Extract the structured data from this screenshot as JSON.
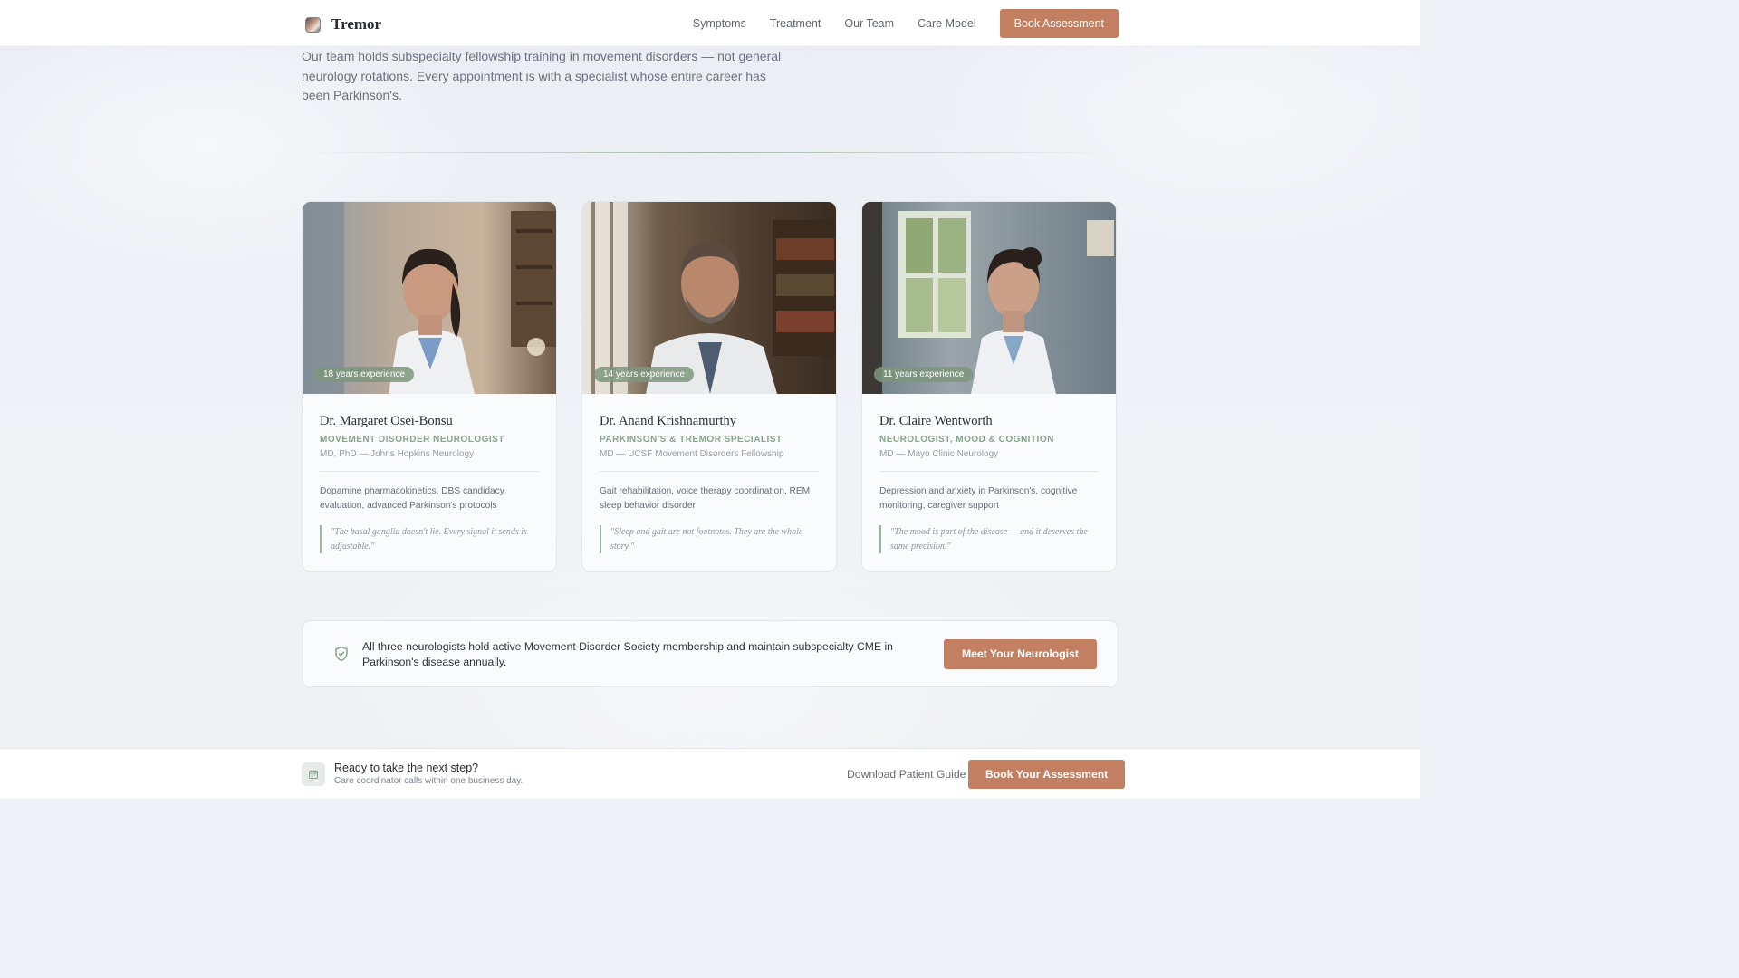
{
  "brand": {
    "name": "Tremor"
  },
  "nav": {
    "items": [
      "Symptoms",
      "Treatment",
      "Our Team",
      "Care Model"
    ],
    "cta_label": "Book Assessment"
  },
  "intro": {
    "text": "Our team holds subspecialty fellowship training in movement disorders — not general neurology rotations. Every appointment is with a specialist whose entire career has been Parkinson's."
  },
  "doctors": [
    {
      "experience": "18 years experience",
      "name": "Dr. Margaret Osei-Bonsu",
      "title": "MOVEMENT DISORDER NEUROLOGIST",
      "credentials": "MD, PhD — Johns Hopkins Neurology",
      "focus": "Dopamine pharmacokinetics, DBS candidacy evaluation, advanced Parkinson's protocols",
      "quote": "\"The basal ganglia doesn't lie. Every signal it sends is adjustable.\""
    },
    {
      "experience": "14 years experience",
      "name": "Dr. Anand Krishnamurthy",
      "title": "PARKINSON'S & TREMOR SPECIALIST",
      "credentials": "MD — UCSF Movement Disorders Fellowship",
      "focus": "Gait rehabilitation, voice therapy coordination, REM sleep behavior disorder",
      "quote": "\"Sleep and gait are not footnotes. They are the whole story.\""
    },
    {
      "experience": "11 years experience",
      "name": "Dr. Claire Wentworth",
      "title": "NEUROLOGIST, MOOD & COGNITION",
      "credentials": "MD — Mayo Clinic Neurology",
      "focus": "Depression and anxiety in Parkinson's, cognitive monitoring, caregiver support",
      "quote": "\"The mood is part of the disease — and it deserves the same precision.\""
    }
  ],
  "banner": {
    "icon": "shield-check-icon",
    "text": "All three neurologists hold active Movement Disorder Society membership and maintain subspecialty CME in Parkinson's disease annually.",
    "cta_label": "Meet Your Neurologist"
  },
  "sticky_bar": {
    "icon": "calendar-icon",
    "title": "Ready to take the next step?",
    "subtitle": "Care coordinator calls within one business day.",
    "link_label": "Download Patient Guide",
    "cta_label": "Book Your Assessment"
  },
  "colors": {
    "accent": "#c27f62",
    "sage": "#86a58a",
    "background": "#eef1f5"
  }
}
